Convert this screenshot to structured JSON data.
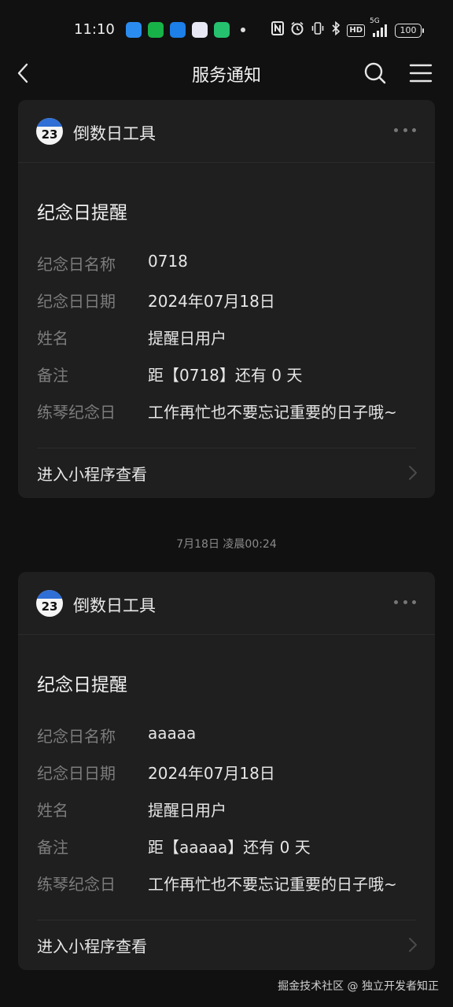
{
  "status_bar": {
    "time": "11:10",
    "network": "5G",
    "battery": "100"
  },
  "nav": {
    "title": "服务通知"
  },
  "timestamp": "7月18日 凌晨00:24",
  "cards": [
    {
      "app_name": "倒数日工具",
      "calendar_number": "23",
      "title": "纪念日提醒",
      "fields": [
        {
          "label": "纪念日名称",
          "value": "0718"
        },
        {
          "label": "纪念日日期",
          "value": "2024年07月18日"
        },
        {
          "label": "姓名",
          "value": "提醒日用户"
        },
        {
          "label": "备注",
          "value": "距【0718】还有 0 天"
        },
        {
          "label": "练琴纪念日",
          "value": "工作再忙也不要忘记重要的日子哦~"
        }
      ],
      "footer_label": "进入小程序查看"
    },
    {
      "app_name": "倒数日工具",
      "calendar_number": "23",
      "title": "纪念日提醒",
      "fields": [
        {
          "label": "纪念日名称",
          "value": "aaaaa"
        },
        {
          "label": "纪念日日期",
          "value": "2024年07月18日"
        },
        {
          "label": "姓名",
          "value": "提醒日用户"
        },
        {
          "label": "备注",
          "value": "距【aaaaa】还有 0 天"
        },
        {
          "label": "练琴纪念日",
          "value": "工作再忙也不要忘记重要的日子哦~"
        }
      ],
      "footer_label": "进入小程序查看"
    }
  ],
  "watermark": "掘金技术社区 @ 独立开发者知正",
  "colors": {
    "background": "#111111",
    "card": "#1f1f1f",
    "label": "#7c7c7c",
    "value": "#e6e6e6"
  }
}
